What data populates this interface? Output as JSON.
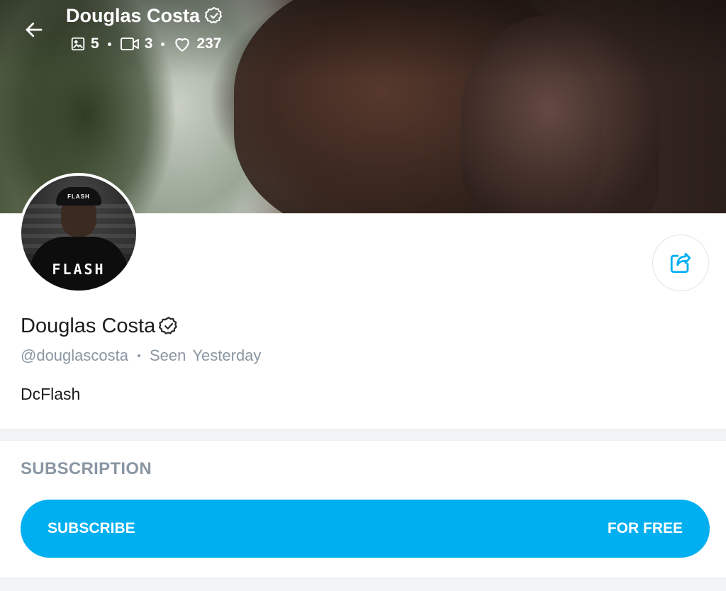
{
  "header": {
    "name": "Douglas Costa",
    "stats": {
      "photos": "5",
      "videos": "3",
      "likes": "237"
    }
  },
  "icons": {
    "back": "arrow-left-icon",
    "verified": "verified-badge-icon",
    "photo": "image-icon",
    "video": "video-camera-icon",
    "like": "heart-icon",
    "share": "share-icon"
  },
  "avatar": {
    "cap_text": "FLASH",
    "shirt_text": "FLASH"
  },
  "profile": {
    "name": "Douglas Costa",
    "username": "@douglascosta",
    "seen_label": "Seen",
    "seen_value": "Yesterday",
    "bio": "DcFlash"
  },
  "subscription": {
    "title": "SUBSCRIPTION",
    "button_label": "SUBSCRIBE",
    "button_price": "FOR FREE"
  },
  "colors": {
    "accent": "#00aff0",
    "muted_text": "#8a96a3",
    "primary_text": "#1c1c1c"
  }
}
